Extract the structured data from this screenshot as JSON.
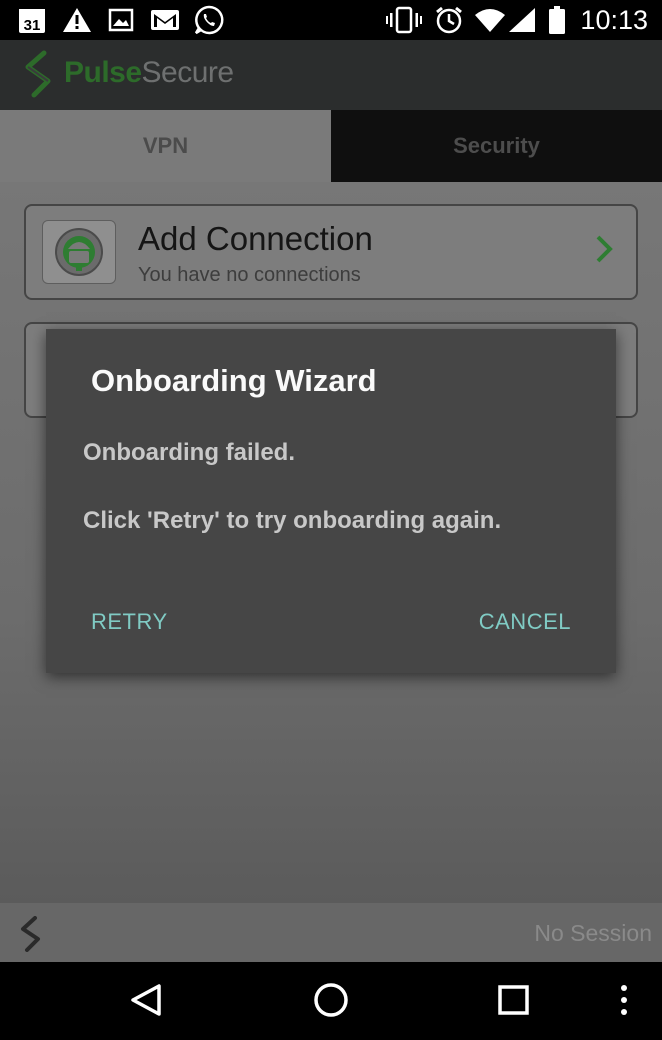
{
  "status_bar": {
    "calendar_day": "31",
    "time": "10:13",
    "icons": [
      "calendar-icon",
      "warning-icon",
      "image-icon",
      "gmail-icon",
      "whatsapp-icon",
      "vibrate-icon",
      "alarm-icon",
      "wifi-icon",
      "signal-icon",
      "battery-icon"
    ]
  },
  "app_bar": {
    "brand_first": "Pulse",
    "brand_second": "Secure"
  },
  "tabs": [
    {
      "label": "VPN",
      "selected": true
    },
    {
      "label": "Security",
      "selected": false
    }
  ],
  "connections": [
    {
      "title": "Add Connection",
      "subtitle": "You have no connections"
    }
  ],
  "dialog": {
    "title": "Onboarding Wizard",
    "message_1": "Onboarding failed.",
    "message_2": "Click 'Retry' to try onboarding again.",
    "retry_label": "RETRY",
    "cancel_label": "CANCEL"
  },
  "footer": {
    "session_status": "No Session"
  },
  "colors": {
    "brand_green": "#2d6b2a",
    "dialog_button": "#80cbc4",
    "chevron_green": "#2e7d32"
  }
}
